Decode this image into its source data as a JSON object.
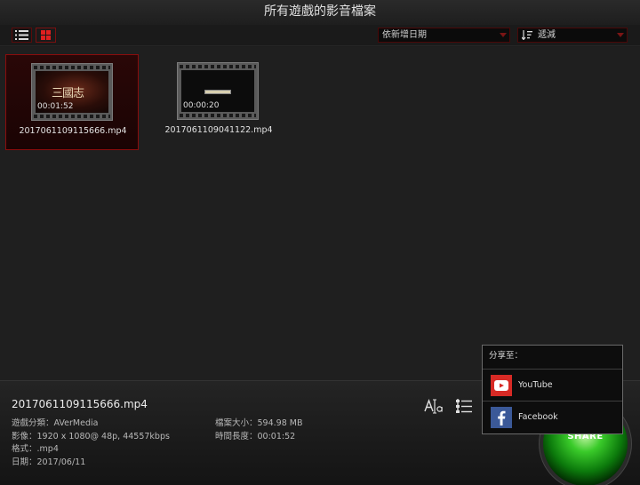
{
  "window": {
    "title": "所有遊戲的影音檔案"
  },
  "toolbar": {
    "list_view_icon": "list-icon",
    "grid_view_icon": "grid-icon",
    "sort_select": {
      "value": "依新增日期"
    },
    "filter_select": {
      "value": "遞減",
      "icon": "sort-descending-icon"
    }
  },
  "files": [
    {
      "name": "2017061109115666.mp4",
      "duration": "00:01:52",
      "thumbnail_text": "三國志"
    },
    {
      "name": "2017061109041122.mp4",
      "duration": "00:00:20"
    }
  ],
  "details": {
    "filename": "2017061109115666.mp4",
    "category_label": "遊戲分類：",
    "category_value": "AVerMedia",
    "video_label": "影像：",
    "video_value": "1920 x 1080@ 48p, 44557kbps",
    "format_label": "格式：",
    "format_value": ".mp4",
    "date_label": "日期：",
    "date_value": "2017/06/11",
    "size_label": "檔案大小：",
    "size_value": "594.98 MB",
    "length_label": "時間長度：",
    "length_value": "00:01:52"
  },
  "share": {
    "button_label": "SHARE",
    "popup_title": "分享至：",
    "targets": [
      {
        "label": "YouTube",
        "icon": "youtube-icon",
        "color": "#e52d27"
      },
      {
        "label": "Facebook",
        "icon": "facebook-icon",
        "color": "#3b5998"
      }
    ]
  }
}
